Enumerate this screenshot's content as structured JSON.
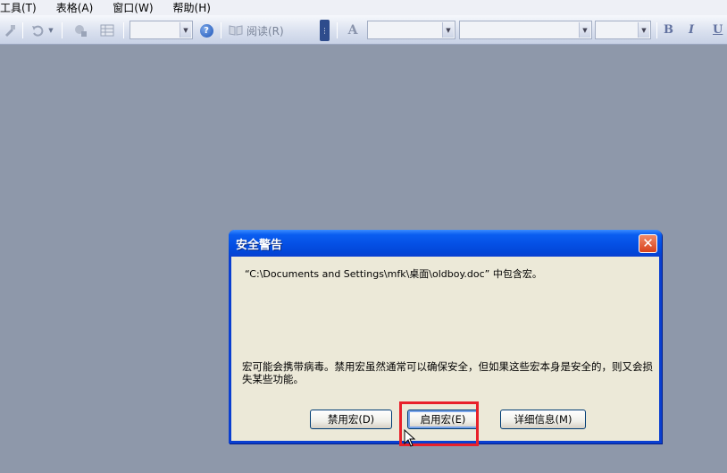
{
  "menubar": {
    "items": [
      {
        "label": "工具(T)"
      },
      {
        "label": "表格(A)"
      },
      {
        "label": "窗口(W)"
      },
      {
        "label": "帮助(H)"
      }
    ]
  },
  "toolbar": {
    "read_label": "阅读(R)",
    "help_icon": "?",
    "format_buttons": {
      "bold": "B",
      "italic": "I",
      "underline": "U"
    },
    "colors": {
      "grip": "#2e4c8c"
    }
  },
  "dialog": {
    "title": "安全警告",
    "message_line1": "“C:\\Documents and Settings\\mfk\\桌面\\oldboy.doc” 中包含宏。",
    "message_line2": "宏可能会携带病毒。禁用宏虽然通常可以确保安全，但如果这些宏本身是安全的，则又会损失某些功能。",
    "buttons": {
      "disable": "禁用宏(D)",
      "enable": "启用宏(E)",
      "details": "详细信息(M)"
    },
    "close_symbol": "✕",
    "colors": {
      "titlebar": "#0551e6",
      "body": "#ece9d8",
      "highlight": "#e8202a"
    }
  }
}
